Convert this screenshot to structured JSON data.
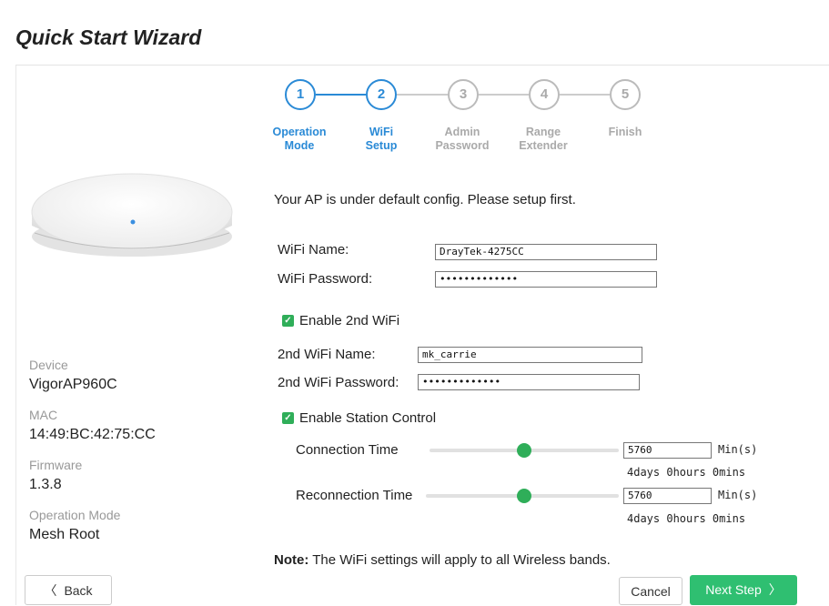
{
  "header": {
    "title": "Quick Start Wizard"
  },
  "steps": [
    {
      "number": "1",
      "label_line1": "Operation",
      "label_line2": "Mode",
      "active": true
    },
    {
      "number": "2",
      "label_line1": "WiFi",
      "label_line2": "Setup",
      "active": true
    },
    {
      "number": "3",
      "label_line1": "Admin",
      "label_line2": "Password",
      "active": false
    },
    {
      "number": "4",
      "label_line1": "Range",
      "label_line2": "Extender",
      "active": false
    },
    {
      "number": "5",
      "label_line1": "Finish",
      "label_line2": "",
      "active": false
    }
  ],
  "device_info": {
    "device_label": "Device",
    "device_value": "VigorAP960C",
    "mac_label": "MAC",
    "mac_value": "14:49:BC:42:75:CC",
    "firmware_label": "Firmware",
    "firmware_value": "1.3.8",
    "mode_label": "Operation Mode",
    "mode_value": "Mesh Root"
  },
  "form": {
    "intro": "Your AP is under default config. Please setup first.",
    "wifi_name_label": "WiFi Name:",
    "wifi_name_value": "DrayTek-4275CC",
    "wifi_password_label": "WiFi Password:",
    "wifi_password_value": "•••••••••••••",
    "enable_2nd_wifi_label": "Enable 2nd WiFi",
    "enable_2nd_wifi_checked": true,
    "wifi2_name_label": "2nd WiFi Name:",
    "wifi2_name_value": "mk_carrie",
    "wifi2_password_label": "2nd WiFi Password:",
    "wifi2_password_value": "•••••••••••••",
    "enable_station_control_label": "Enable Station Control",
    "enable_station_control_checked": true,
    "connection_time_label": "Connection Time",
    "connection_time_value": "5760",
    "connection_time_unit": "Min(s)",
    "connection_time_desc": "4days 0hours 0mins",
    "connection_slider_fraction": 0.5,
    "reconnection_time_label": "Reconnection Time",
    "reconnection_time_value": "5760",
    "reconnection_time_unit": "Min(s)",
    "reconnection_time_desc": "4days 0hours 0mins",
    "reconnection_slider_fraction": 0.5,
    "note_bold": "Note:",
    "note_text": " The WiFi settings will apply to all Wireless bands."
  },
  "footer": {
    "back_label": "Back",
    "cancel_label": "Cancel",
    "next_label": "Next Step"
  },
  "colors": {
    "accent_blue": "#2a8ad6",
    "accent_green": "#2fbf71",
    "check_green": "#2fae59"
  }
}
